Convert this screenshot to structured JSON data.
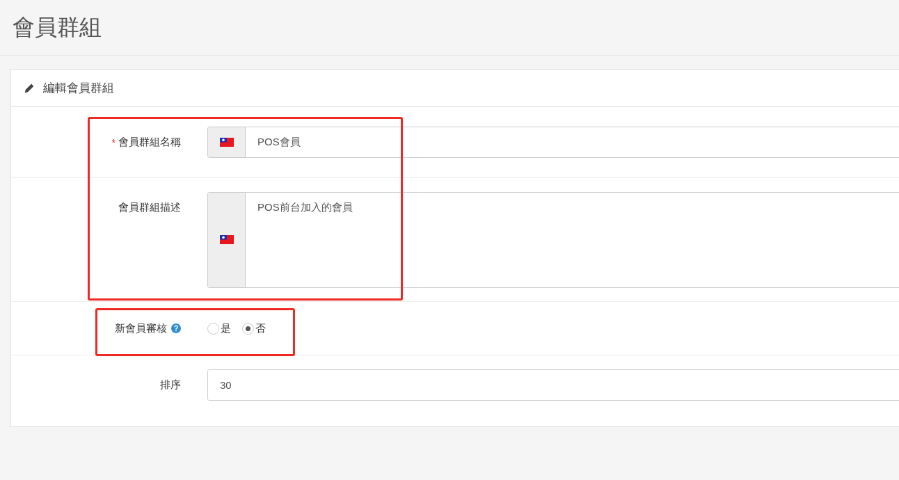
{
  "page_title": "會員群組",
  "panel": {
    "title": "編輯會員群組"
  },
  "fields": [
    {
      "kind": "text",
      "required_mark": "*",
      "label": "會員群組名稱",
      "flag": true,
      "value": "POS會員"
    },
    {
      "kind": "textarea",
      "label": "會員群組描述",
      "flag": true,
      "value": "POS前台加入的會員"
    },
    {
      "kind": "radio",
      "label": "新會員審核",
      "help": true,
      "options": [
        {
          "label": "是",
          "selected": false
        },
        {
          "label": "否",
          "selected": true
        }
      ]
    },
    {
      "kind": "text",
      "label": "排序",
      "flag": false,
      "value": "30"
    }
  ]
}
